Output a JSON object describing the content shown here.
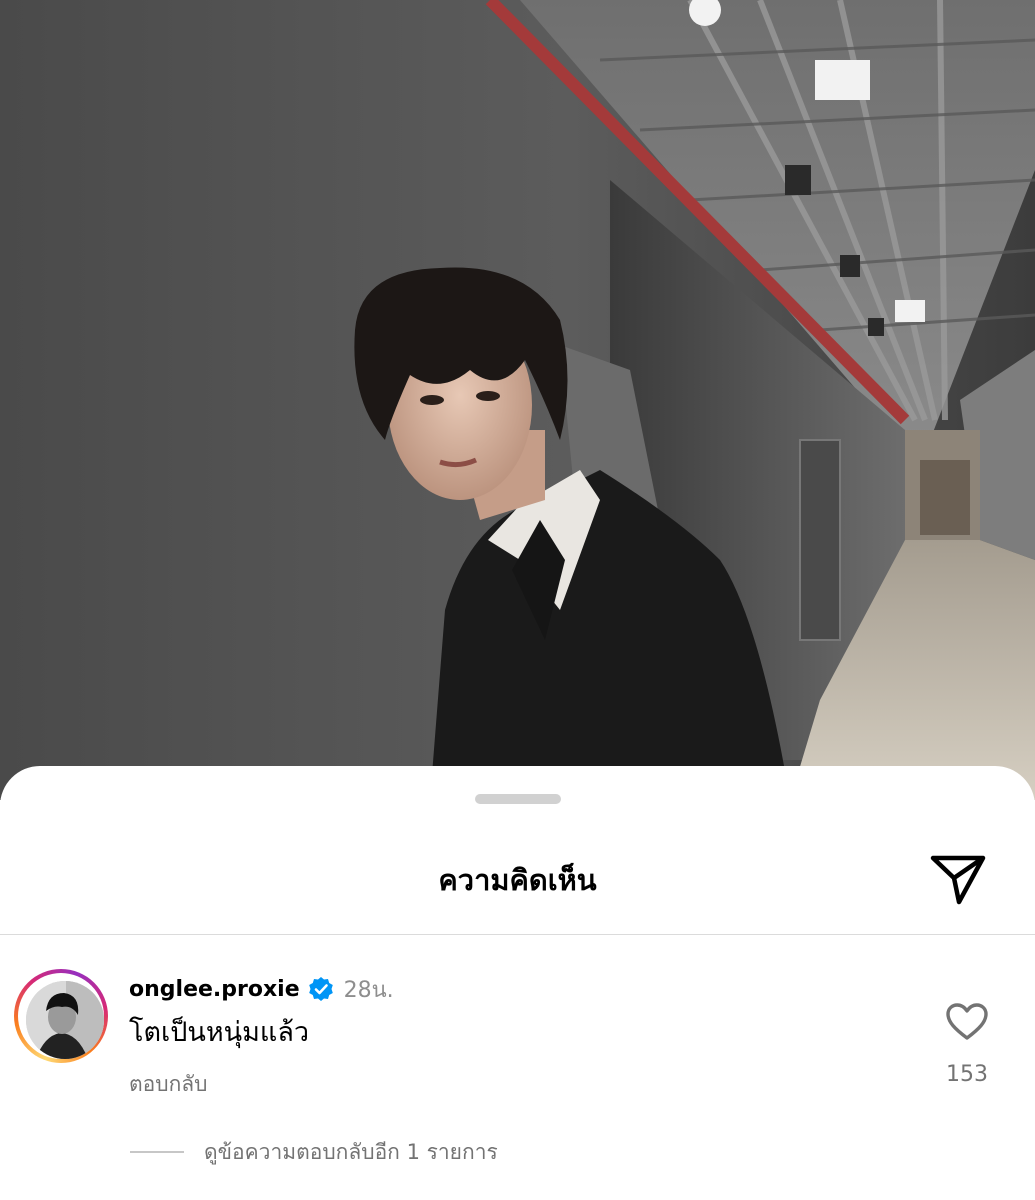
{
  "post": {
    "photo_icon": "portrait-photo"
  },
  "sheet": {
    "title": "ความคิดเห็น",
    "share_icon": "paper-plane-icon"
  },
  "comment": {
    "username": "onglee.proxie",
    "verified_icon": "verified-badge-icon",
    "time": "28น.",
    "text": "โตเป็นหนุ่มแล้ว",
    "reply_label": "ตอบกลับ",
    "like_icon": "heart-outline-icon",
    "like_count": "153",
    "more_replies_label": "ดูข้อความตอบกลับอีก 1 รายการ",
    "avatar_ring_colors": [
      "#feda75",
      "#fa7e1e",
      "#d62976",
      "#962fbf"
    ],
    "verified_color": "#0095f6"
  }
}
